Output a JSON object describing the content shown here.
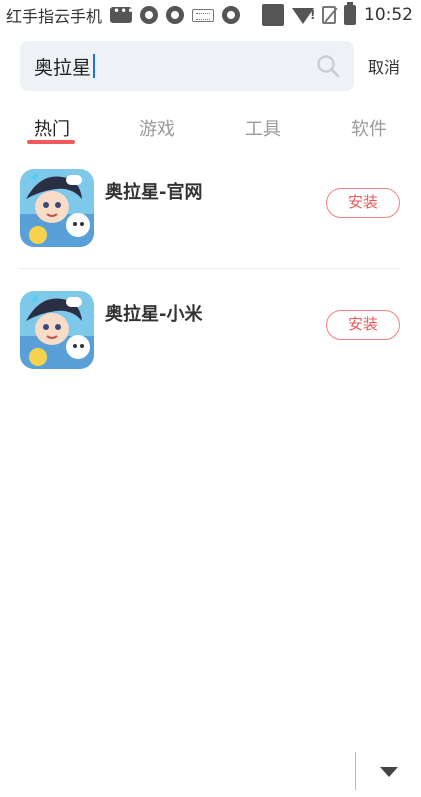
{
  "status_bar": {
    "carrier": "红手指云手机",
    "time": "10:52",
    "icons": [
      "message-icon",
      "sync-icon",
      "sync-icon",
      "keyboard-icon",
      "sync-icon",
      "square-icon",
      "wifi-icon",
      "no-sim-icon",
      "battery-icon"
    ]
  },
  "search": {
    "value": "奥拉星",
    "cancel_label": "取消"
  },
  "tabs": [
    {
      "label": "热门",
      "active": true
    },
    {
      "label": "游戏",
      "active": false
    },
    {
      "label": "工具",
      "active": false
    },
    {
      "label": "软件",
      "active": false
    }
  ],
  "apps": [
    {
      "name": "奥拉星-官网",
      "button": "安装"
    },
    {
      "name": "奥拉星-小米",
      "button": "安装"
    }
  ],
  "colors": {
    "accent": "#f05a5a",
    "search_bg": "#eef1f6"
  }
}
